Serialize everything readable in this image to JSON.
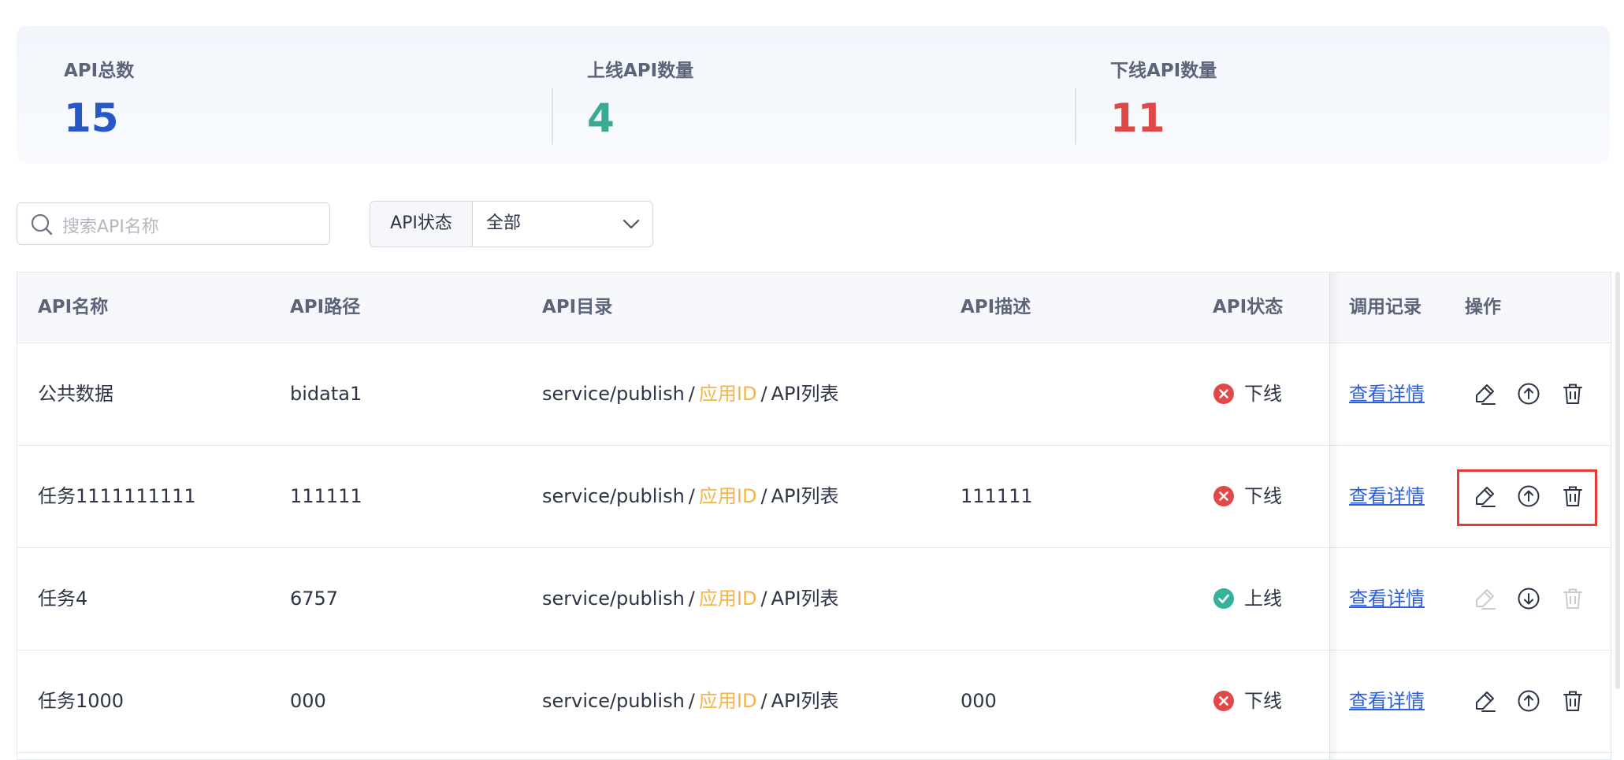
{
  "stats": [
    {
      "label": "API总数",
      "value": "15",
      "color": "#2857c8"
    },
    {
      "label": "上线API数量",
      "value": "4",
      "color": "#3aaa95"
    },
    {
      "label": "下线API数量",
      "value": "11",
      "color": "#e04848"
    }
  ],
  "filters": {
    "search_placeholder": "搜索API名称",
    "status_label": "API状态",
    "status_value": "全部"
  },
  "table": {
    "columns": [
      "API名称",
      "API路径",
      "API目录",
      "API描述",
      "API状态",
      "调用记录",
      "操作"
    ],
    "rows": [
      {
        "name": "公共数据",
        "path": "bidata1",
        "dir": [
          "service/publish",
          "应用ID",
          "API列表"
        ],
        "desc": "",
        "status": "下线",
        "status_icon": "offline-x-icon",
        "record": "查看详情",
        "actions": [
          "edit-icon",
          "publish-up-icon",
          "delete-icon"
        ]
      },
      {
        "name": "任务1111111111",
        "path": "111111",
        "dir": [
          "service/publish",
          "应用ID",
          "API列表"
        ],
        "desc": "111111",
        "status": "下线",
        "status_icon": "offline-x-icon",
        "record": "查看详情",
        "actions": [
          "edit-icon",
          "publish-up-icon",
          "delete-icon"
        ]
      },
      {
        "name": "任务4",
        "path": "6757",
        "dir": [
          "service/publish",
          "应用ID",
          "API列表"
        ],
        "desc": "",
        "status": "上线",
        "status_icon": "online-check-icon",
        "record": "查看详情",
        "actions": [
          "edit-icon-disabled",
          "unpublish-down-icon",
          "delete-icon-disabled"
        ]
      },
      {
        "name": "任务1000",
        "path": "000",
        "dir": [
          "service/publish",
          "应用ID",
          "API列表"
        ],
        "desc": "000",
        "status": "下线",
        "status_icon": "offline-x-icon",
        "record": "查看详情",
        "actions": [
          "edit-icon",
          "publish-up-icon",
          "delete-icon"
        ]
      }
    ]
  },
  "colors": {
    "online": "#35b29a",
    "offline": "#e34848",
    "link": "#2d5fd8",
    "app_id": "#f5b44a",
    "highlight": "#e53935"
  }
}
